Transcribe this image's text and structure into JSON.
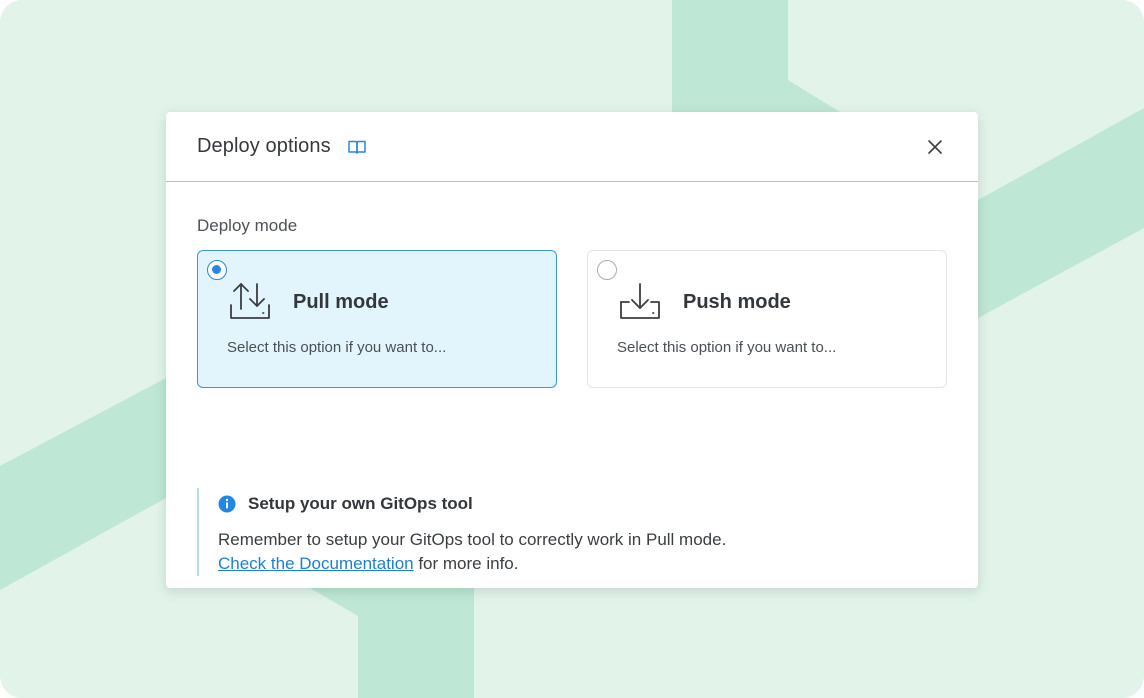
{
  "modal": {
    "title": "Deploy options",
    "section_label": "Deploy mode"
  },
  "modes": [
    {
      "title": "Pull mode",
      "description": "Select this option if you want to...",
      "selected": true
    },
    {
      "title": "Push mode",
      "description": "Select this option if you want to...",
      "selected": false
    }
  ],
  "callout": {
    "title": "Setup your own GitOps tool",
    "line1": "Remember to setup your GitOps tool to correctly work in Pull mode.",
    "link_text": "Check the Documentation",
    "line2_suffix": " for more info."
  },
  "colors": {
    "backdrop": "#e2f4ea",
    "backdrop_band": "#bfe7d5",
    "accent": "#2a86de",
    "selected_card": "#e2f5fd",
    "link": "#1e7fd0"
  },
  "icons": {
    "docs": "book-icon",
    "close": "close-icon",
    "pull": "upload-download-tray-icon",
    "push": "download-tray-icon",
    "info": "info-icon"
  }
}
